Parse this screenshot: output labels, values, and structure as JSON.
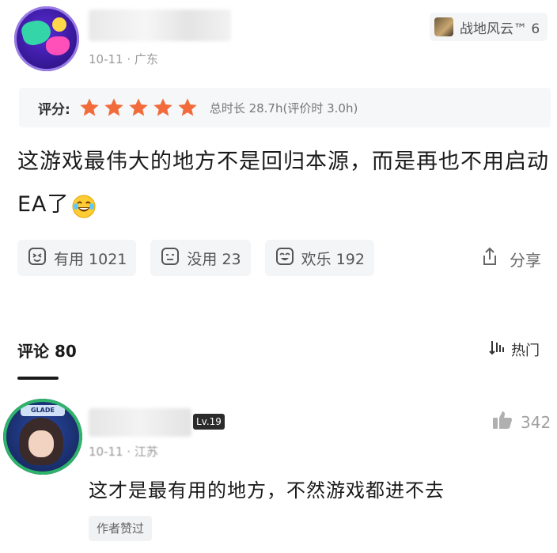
{
  "review": {
    "meta": "10-11 · 广东",
    "game_tag": "战地风云™ 6",
    "rating_label": "评分:",
    "rating_stars": 5,
    "star_color": "#f26b3a",
    "playtime": "总时长 28.7h(评价时 3.0h)",
    "text": "这游戏最伟大的地方不是回归本源，而是再也不用启动EA了",
    "emoji": "laughing-tears-emoji",
    "reactions": [
      {
        "icon": "helpful-face-icon",
        "label": "有用 1021"
      },
      {
        "icon": "unhelpful-face-icon",
        "label": "没用 23"
      },
      {
        "icon": "funny-face-icon",
        "label": "欢乐 192"
      }
    ],
    "share_label": "分享"
  },
  "comments": {
    "header": "评论 80",
    "sort_label": "热门",
    "items": [
      {
        "level": "Lv.19",
        "likes": "342",
        "meta": "10-11 · 江苏",
        "text": "这才是最有用的地方，不然游戏都进不去",
        "author_liked": "作者赞过",
        "avatar_band": "GLADE"
      }
    ]
  }
}
